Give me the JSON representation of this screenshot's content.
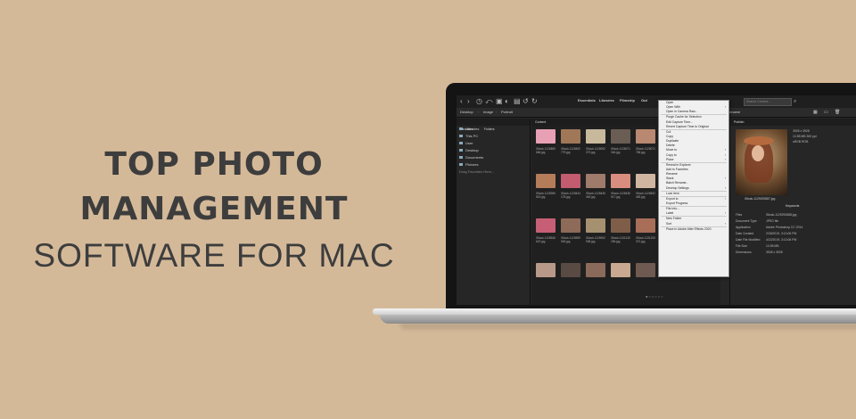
{
  "headline": {
    "line1": "TOP PHOTO",
    "line2": "MANAGEMENT",
    "line3": "SOFTWARE FOR MAC"
  },
  "app": {
    "workspaces": [
      "Essentials",
      "Libraries",
      "Filmstrip",
      "Out"
    ],
    "search_placeholder": "Search Current...",
    "breadcrumb": [
      "Desktop",
      "Image",
      "Portrait"
    ],
    "sort_label": "By Filename",
    "left_tabs": [
      "Favorites",
      "Folders"
    ],
    "favorites": [
      "Libraries",
      "This PC",
      "User",
      "Desktop",
      "Documents",
      "Pictures"
    ],
    "favorites_hint": "Drag Favorites Here...",
    "content_tab": "Content",
    "thumbnails": [
      {
        "label": "iStock-1126859 666.jpg",
        "color": "#e8a0b4"
      },
      {
        "label": "iStock-1128492 779.jpg",
        "color": "#a07858"
      },
      {
        "label": "iStock-1128092 373.jpg",
        "color": "#c8b89c"
      },
      {
        "label": "iStock-1128071 346.jpg",
        "color": "#6a5e54"
      },
      {
        "label": "iStock-1128071 786.jpg",
        "color": "#b88870"
      },
      {
        "label": "iStock-1128396 815.jpg",
        "color": "#b57c5a"
      },
      {
        "label": "iStock-1128434 178.jpg",
        "color": "#c25c6e"
      },
      {
        "label": "iStock-1128436 463.jpg",
        "color": "#9e7b6b"
      },
      {
        "label": "iStock-1128436 517.jpg",
        "color": "#d98d7e"
      },
      {
        "label": "iStock-1128452 483.jpg",
        "color": "#d0b6a0"
      },
      {
        "label": "iStock-1128536 622.jpg",
        "color": "#c65f75"
      },
      {
        "label": "iStock-1128559 945.jpg",
        "color": "#8e6a58"
      },
      {
        "label": "iStock-1128942 938.jpg",
        "color": "#a59070"
      },
      {
        "label": "iStock-1131130 296.jpg",
        "color": "#7e5e48"
      },
      {
        "label": "iStock-1131205 372.jpg",
        "color": "#a86e58"
      },
      {
        "label": "",
        "color": "#b89888"
      },
      {
        "label": "",
        "color": "#5a4a44"
      },
      {
        "label": "",
        "color": "#8a6a5a"
      },
      {
        "label": "",
        "color": "#c8a890"
      },
      {
        "label": "",
        "color": "#6e5a50"
      }
    ],
    "context_menu": [
      {
        "label": "Open"
      },
      {
        "label": "Open With",
        "sub": true
      },
      {
        "label": "Open in Camera Raw..."
      },
      {
        "sep": true
      },
      {
        "label": "Purge Cache for Selection"
      },
      {
        "label": "Edit Capture Time..."
      },
      {
        "label": "Revert Capture Time to Original"
      },
      {
        "sep": true
      },
      {
        "label": "Cut"
      },
      {
        "label": "Copy"
      },
      {
        "label": "Duplicate"
      },
      {
        "label": "Delete"
      },
      {
        "label": "Move to",
        "sub": true
      },
      {
        "label": "Copy to",
        "sub": true
      },
      {
        "label": "Place",
        "sub": true
      },
      {
        "sep": true
      },
      {
        "label": "Reveal in Explorer"
      },
      {
        "label": "Add to Favorites"
      },
      {
        "label": "Rename"
      },
      {
        "label": "Stack",
        "sub": true
      },
      {
        "label": "Batch Rename..."
      },
      {
        "label": "Develop Settings",
        "sub": true
      },
      {
        "sep": true
      },
      {
        "label": "Lock Item"
      },
      {
        "sep": true
      },
      {
        "label": "Export to",
        "sub": true
      },
      {
        "label": "Export Progress"
      },
      {
        "sep": true
      },
      {
        "label": "File Info..."
      },
      {
        "label": "Label",
        "sub": true
      },
      {
        "sep": true
      },
      {
        "label": "New Folder"
      },
      {
        "label": "Sort",
        "sub": true
      },
      {
        "sep": true
      },
      {
        "label": "Place In Adobe After Effects 2020"
      }
    ],
    "right_tab": "Publish",
    "preview_name": "iStock-1129292887.jpg",
    "keywords_tab": "Keywords",
    "meta_rows": [
      {
        "k": "",
        "v": "3928 x 3928"
      },
      {
        "k": "",
        "v": "13.55 MB   300 ppi"
      },
      {
        "k": "",
        "v": "sRGB        RGB"
      }
    ],
    "file_props": [
      {
        "k": "Files",
        "v": "iStock-1129292888.jpg"
      },
      {
        "k": "Document Type",
        "v": "JPEG file"
      },
      {
        "k": "Application",
        "v": "Adobe Photoshop CC 2014"
      },
      {
        "k": "Date Created",
        "v": "2/26/2019, 3:13:06 PM"
      },
      {
        "k": "Date File Modified",
        "v": "4/22/2019, 3:13:06 PM"
      },
      {
        "k": "File Size",
        "v": "13.55 MB"
      },
      {
        "k": "Dimensions",
        "v": "3928 x 3928"
      }
    ]
  }
}
